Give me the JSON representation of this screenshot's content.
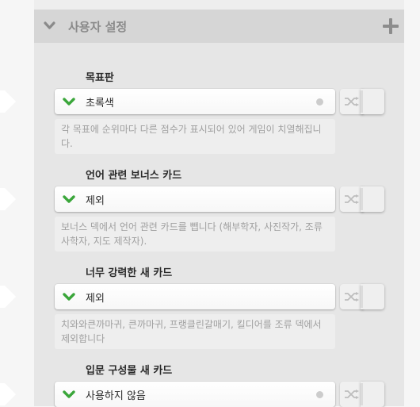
{
  "section": {
    "title": "사용자 설정",
    "collapse_icon": "chevron-down-icon",
    "add_icon": "plus-icon"
  },
  "settings": [
    {
      "title": "목표판",
      "value": "초록색",
      "has_dot": true,
      "description": "각 목표에 순위마다 다른 점수가 표시되어 있어 게임이 치열해집니다."
    },
    {
      "title": "언어 관련 보너스 카드",
      "value": "제외",
      "has_dot": false,
      "description": "보너스 덱에서 언어 관련 카드를 뺍니다 (해부학자, 사진작가, 조류사학자, 지도 제작자)."
    },
    {
      "title": "너무 강력한 새 카드",
      "value": "제외",
      "has_dot": false,
      "description": "치와와큰까마귀, 큰까마귀, 프랭클린갈매기, 킬디어를 조류 덱에서 제외합니다"
    },
    {
      "title": "입문 구성물 새 카드",
      "value": "사용하지 않음",
      "has_dot": true,
      "description": ""
    }
  ],
  "colors": {
    "check_green": "#3aa63a",
    "header_bg": "#d6d6d6",
    "panel_bg": "#e6e6e6"
  }
}
